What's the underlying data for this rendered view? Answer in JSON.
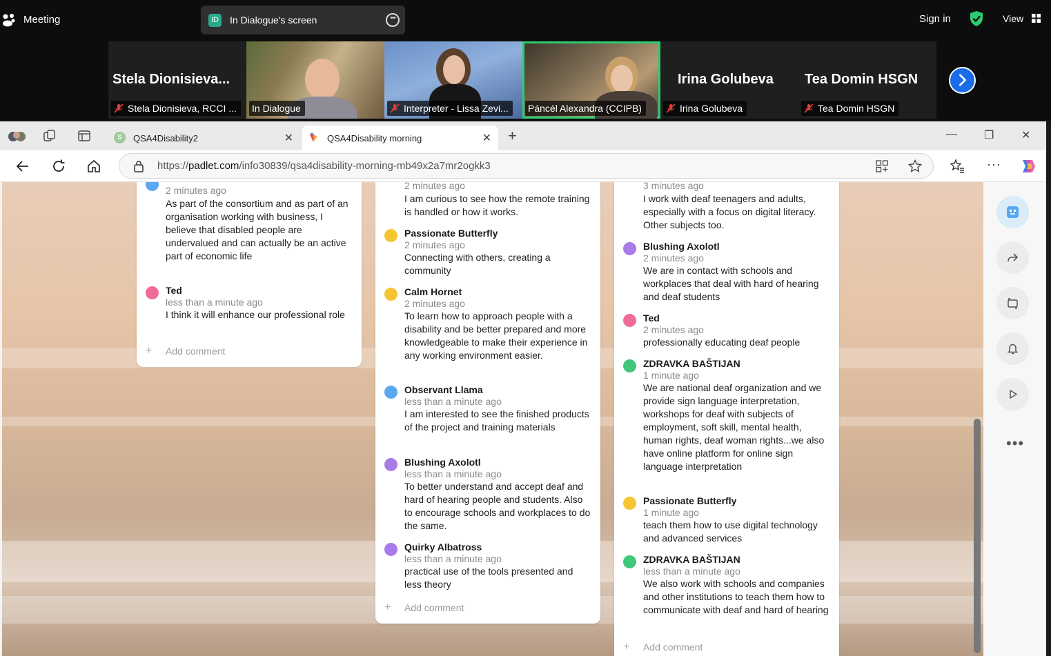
{
  "meeting": {
    "title": "Meeting",
    "screen_share_label": "In Dialogue's screen",
    "screen_share_badge": "ID",
    "sign_in": "Sign in",
    "view": "View",
    "participants": [
      {
        "big_name": "Stela  Dionisieva...",
        "label": "Stela Dionisieva, RCCI ...",
        "muted": true
      },
      {
        "big_name": "",
        "label": "In Dialogue",
        "muted": false
      },
      {
        "big_name": "",
        "label": "Interpreter - Lissa Zevi...",
        "muted": true
      },
      {
        "big_name": "",
        "label": "Páncél Alexandra (CCIPB)",
        "muted": false
      },
      {
        "big_name": "Irina Golubeva",
        "label": "Irina Golubeva",
        "muted": true
      },
      {
        "big_name": "Tea Domin HSGN",
        "label": "Tea Domin HSGN",
        "muted": true
      }
    ]
  },
  "browser": {
    "tabs": [
      {
        "title": "QSA4Disability2",
        "favicon_letter": "S"
      },
      {
        "title": "QSA4Disability morning"
      }
    ],
    "url_prefix": "https://",
    "url_host": "padlet.com",
    "url_path": "/info30839/qsa4disability-morning-mb49x2a7mr2ogkk3"
  },
  "padlet": {
    "add_comment_label": "Add comment",
    "col1": {
      "cut_top_time": "2 minutes ago",
      "cut_top_text": "As part of the consortium and as part of an organisation working with business, I believe that disabled people are undervalued and can actually be an active part of economic life",
      "comments": [
        {
          "name": "Ted",
          "time": "less than a minute ago",
          "text": "I think it will enhance our professional role"
        }
      ]
    },
    "col2": {
      "cut_top_time": "2 minutes ago",
      "cut_top_text": "I am curious to see how the remote training is handled or how it works.",
      "comments": [
        {
          "name": "Passionate Butterfly",
          "time": "2 minutes ago",
          "text": "Connecting with others, creating a community"
        },
        {
          "name": "Calm Hornet",
          "time": "2 minutes ago",
          "text": "To learn how to approach people with a disability and be better prepared and more knowledgeable to make their experience in any working environment easier."
        },
        {
          "name": "Observant Llama",
          "time": "less than a minute ago",
          "text": "I am interested to see the finished products of the project and training materials"
        },
        {
          "name": "Blushing Axolotl",
          "time": "less than a minute ago",
          "text": "To better understand and accept deaf and hard of hearing people and students. Also to encourage schools and workplaces to do the same."
        },
        {
          "name": "Quirky Albatross",
          "time": "less than a minute ago",
          "text": "practical use of the tools presented and less theory"
        }
      ]
    },
    "col3": {
      "cut_top_time": "3 minutes ago",
      "cut_top_text": "I work with deaf teenagers and adults, especially with a focus on digital literacy. Other subjects too.",
      "comments": [
        {
          "name": "Blushing Axolotl",
          "time": "2 minutes ago",
          "text": "We are in contact with schools and workplaces that deal with hard of hearing and deaf students"
        },
        {
          "name": "Ted",
          "time": "2 minutes ago",
          "text": "professionally educating deaf people"
        },
        {
          "name": "ZDRAVKA BAŠTIJAN",
          "time": "1 minute ago",
          "text": "We are national deaf organization and we provide sign language interpretation, workshops for deaf with subjects of employment, soft skill, mental health, human rights, deaf woman rights...we also have online platform for online sign language interpretation"
        },
        {
          "name": "Passionate Butterfly",
          "time": "1 minute ago",
          "text": "teach them how to use digital technology and advanced services"
        },
        {
          "name": "ZDRAVKA BAŠTIJAN",
          "time": "less than a minute ago",
          "text": "We also work with schools and companies and other institutions to teach them how to communicate with deaf and hard of hearing"
        }
      ]
    }
  },
  "colors": {
    "accent_green": "#2ecc71",
    "zoom_blue": "#1a6ce8",
    "avatar_pink": "#f06b95",
    "avatar_yellow": "#f5c532",
    "avatar_blue": "#5aa9f0",
    "avatar_purple": "#a77be8",
    "avatar_green": "#3fc77a"
  }
}
